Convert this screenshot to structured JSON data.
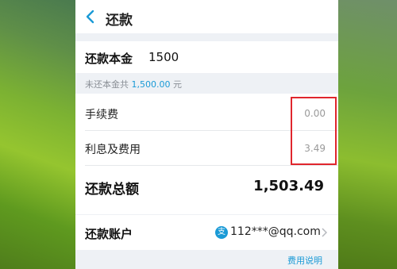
{
  "header": {
    "title": "还款"
  },
  "principal": {
    "label": "还款本金",
    "value": "1500"
  },
  "note": {
    "prefix": "未还本金共 ",
    "amount": "1,500.00",
    "suffix": " 元"
  },
  "fees": {
    "handling_fee": {
      "label": "手续费",
      "value": "0.00"
    },
    "interest": {
      "label": "利息及费用",
      "value": "3.49"
    }
  },
  "total": {
    "label": "还款总额",
    "value": "1,503.49"
  },
  "account": {
    "label": "还款账户",
    "icon_text": "支",
    "value": "112***@qq.com"
  },
  "footer": {
    "link": "费用说明"
  },
  "colors": {
    "accent": "#1a9ad6",
    "highlight": "#e0262d"
  }
}
